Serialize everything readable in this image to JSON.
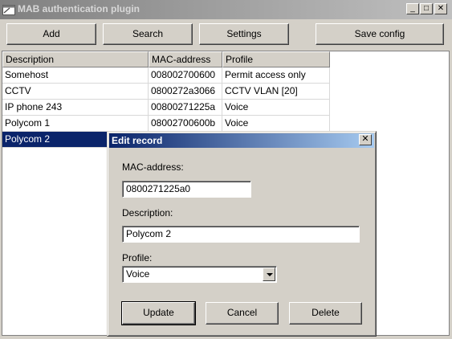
{
  "window": {
    "title": "MAB authentication plugin",
    "minimize": "_",
    "maximize": "□",
    "close": "✕"
  },
  "toolbar": {
    "add": "Add",
    "search": "Search",
    "settings": "Settings",
    "save_config": "Save config"
  },
  "table": {
    "columns": [
      "Description",
      "MAC-address",
      "Profile"
    ],
    "rows": [
      [
        "Somehost",
        "008002700600",
        "Permit access only"
      ],
      [
        "CCTV",
        "0800272a3066",
        "CCTV VLAN [20]"
      ],
      [
        "IP phone 243",
        "00800271225a",
        "Voice"
      ],
      [
        "Polycom 1",
        "08002700600b",
        "Voice"
      ],
      [
        "Polycom 2",
        "",
        ""
      ]
    ],
    "selected_row": 4
  },
  "dialog": {
    "title": "Edit record",
    "close": "✕",
    "mac_label": "MAC-address:",
    "mac_value": "0800271225a0",
    "desc_label": "Description:",
    "desc_value": "Polycom 2",
    "profile_label": "Profile:",
    "profile_value": "Voice",
    "update": "Update",
    "cancel": "Cancel",
    "delete": "Delete"
  },
  "colors": {
    "selection": "#0a246a",
    "face": "#d4d0c8",
    "dialog_title": "#0a246a"
  },
  "icons": {
    "app": "app-window-icon",
    "dropdown": "chevron-down-icon"
  }
}
